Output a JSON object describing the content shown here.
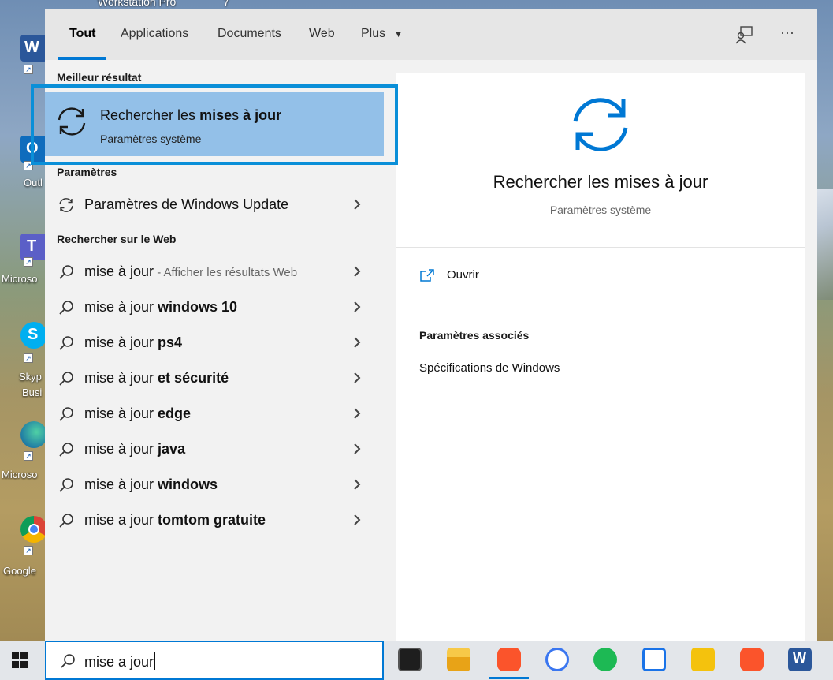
{
  "desktop": {
    "top_label": "Workstation Pro",
    "top_label_num": "7",
    "icon_labels": [
      "Outl",
      "Microso",
      "Skyp",
      "Busi",
      "Microso",
      "Google"
    ]
  },
  "tabs": [
    {
      "label": "Tout",
      "active": true
    },
    {
      "label": "Applications"
    },
    {
      "label": "Documents"
    },
    {
      "label": "Web"
    },
    {
      "label": "Plus"
    }
  ],
  "toolbar": {
    "feedback_icon": "feedback-icon",
    "more_label": "···"
  },
  "best_match": {
    "section": "Meilleur résultat",
    "title_prefix": "Rechercher les ",
    "title_bold_1": "mise",
    "title_mid": "s ",
    "title_bold_2": "à jour",
    "subtitle": "Paramètres système",
    "icon": "sync-icon"
  },
  "settings_section": {
    "section": "Paramètres",
    "item": "Paramètres de Windows Update"
  },
  "web_section": {
    "section": "Rechercher sur le Web",
    "first": {
      "term": "mise à jour",
      "hint": " - Afficher les résultats Web"
    },
    "items": [
      {
        "term": "mise à jour ",
        "bold": "windows 10"
      },
      {
        "term": "mise à jour ",
        "bold": "ps4"
      },
      {
        "term": "mise à jour ",
        "bold": "et sécurité"
      },
      {
        "term": "mise à jour ",
        "bold": "edge"
      },
      {
        "term": "mise à jour ",
        "bold": "java"
      },
      {
        "term": "mise à jour ",
        "bold": "windows"
      },
      {
        "term": "mise a jour ",
        "bold": "tomtom gratuite"
      }
    ]
  },
  "preview": {
    "title": "Rechercher les mises à jour",
    "subtitle": "Paramètres système",
    "open_label": "Ouvrir",
    "related_title": "Paramètres associés",
    "related_link": "Spécifications de Windows"
  },
  "taskbar": {
    "search_value": "mise a jour",
    "apps": [
      "terminal-icon",
      "file-explorer-icon",
      "brave-browser-icon",
      "signal-icon",
      "spotify-icon",
      "app-icon",
      "stethoscope-icon",
      "brave-browser-icon",
      "word-icon"
    ]
  },
  "colors": {
    "accent": "#0078d4",
    "highlight": "#93c0e8",
    "focus_ring": "#0a8fd8"
  }
}
